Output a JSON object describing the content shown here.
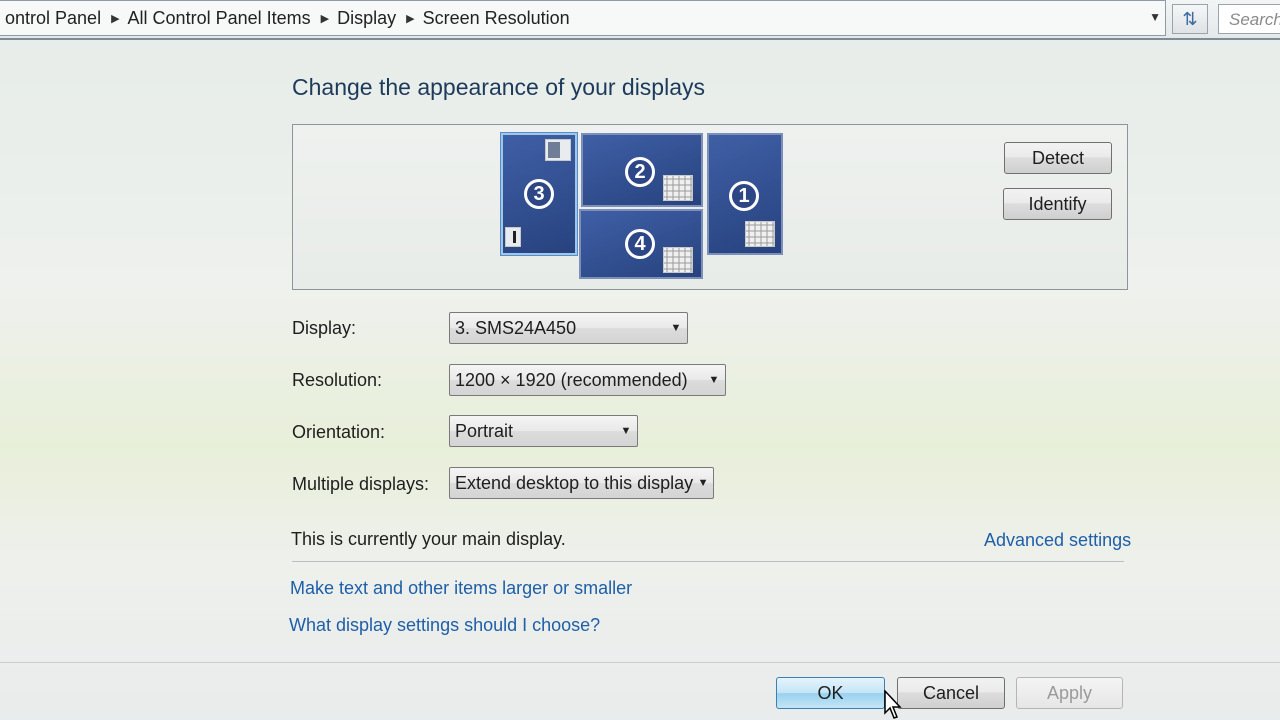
{
  "address_bar": {
    "crumbs": [
      "ontrol Panel",
      "All Control Panel Items",
      "Display",
      "Screen Resolution"
    ],
    "search_placeholder": "Search"
  },
  "main": {
    "heading": "Change the appearance of your displays",
    "monitors": [
      {
        "number": "3",
        "selected": true
      },
      {
        "number": "2",
        "selected": false
      },
      {
        "number": "4",
        "selected": false
      },
      {
        "number": "1",
        "selected": false
      }
    ],
    "detect_label": "Detect",
    "identify_label": "Identify",
    "fields": {
      "display_label": "Display:",
      "display_value": "3. SMS24A450",
      "resolution_label": "Resolution:",
      "resolution_value": "1200 × 1920 (recommended)",
      "orientation_label": "Orientation:",
      "orientation_value": "Portrait",
      "multiple_label": "Multiple displays:",
      "multiple_value": "Extend desktop to this display"
    },
    "main_display_text": "This is currently your main display.",
    "advanced_link": "Advanced settings",
    "link_text_size": "Make text and other items larger or smaller",
    "link_help": "What display settings should I choose?"
  },
  "footer": {
    "ok_label": "OK",
    "cancel_label": "Cancel",
    "apply_label": "Apply"
  },
  "colors": {
    "monitor_blue": "#2f4c8f",
    "link_blue": "#1d5fa8",
    "heading_blue": "#1e3a5b"
  }
}
